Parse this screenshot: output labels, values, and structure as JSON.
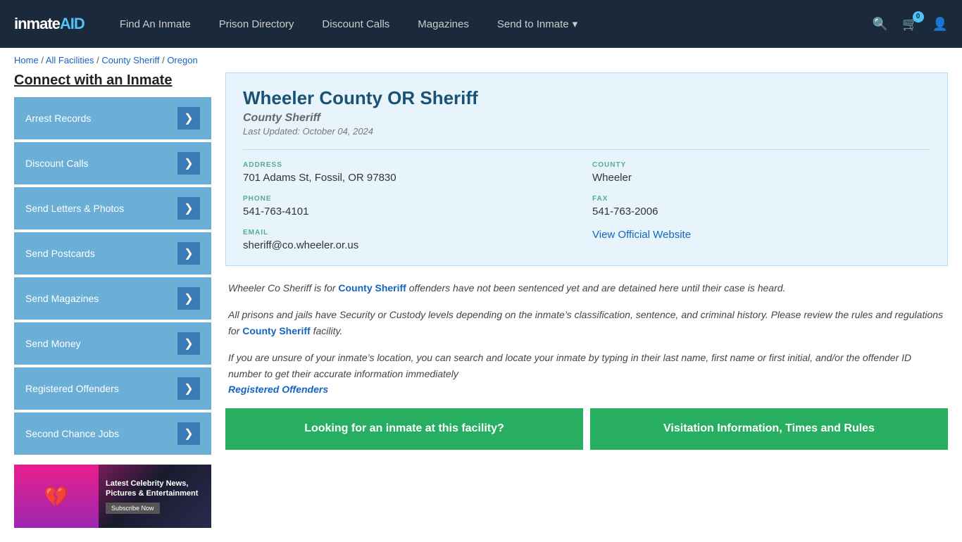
{
  "header": {
    "logo": "inmateAID",
    "logo_badge": "AID",
    "nav": [
      {
        "label": "Find An Inmate",
        "id": "find-inmate"
      },
      {
        "label": "Prison Directory",
        "id": "prison-directory"
      },
      {
        "label": "Discount Calls",
        "id": "discount-calls"
      },
      {
        "label": "Magazines",
        "id": "magazines"
      },
      {
        "label": "Send to Inmate",
        "id": "send-to-inmate",
        "dropdown": true
      }
    ],
    "cart_count": "0"
  },
  "breadcrumb": {
    "home": "Home",
    "all_facilities": "All Facilities",
    "county_sheriff": "County Sheriff",
    "oregon": "Oregon"
  },
  "sidebar": {
    "title": "Connect with an Inmate",
    "items": [
      {
        "label": "Arrest Records",
        "id": "arrest-records"
      },
      {
        "label": "Discount Calls",
        "id": "discount-calls"
      },
      {
        "label": "Send Letters & Photos",
        "id": "send-letters"
      },
      {
        "label": "Send Postcards",
        "id": "send-postcards"
      },
      {
        "label": "Send Magazines",
        "id": "send-magazines"
      },
      {
        "label": "Send Money",
        "id": "send-money"
      },
      {
        "label": "Registered Offenders",
        "id": "registered-offenders"
      },
      {
        "label": "Second Chance Jobs",
        "id": "second-chance-jobs"
      }
    ],
    "ad": {
      "title": "Latest Celebrity News, Pictures & Entertainment",
      "button": "Subscribe Now"
    }
  },
  "facility": {
    "name": "Wheeler County OR Sheriff",
    "type": "County Sheriff",
    "last_updated": "Last Updated: October 04, 2024",
    "address_label": "ADDRESS",
    "address": "701 Adams St, Fossil, OR 97830",
    "county_label": "COUNTY",
    "county": "Wheeler",
    "phone_label": "PHONE",
    "phone": "541-763-4101",
    "fax_label": "FAX",
    "fax": "541-763-2006",
    "email_label": "EMAIL",
    "email": "sheriff@co.wheeler.or.us",
    "website_label": "View Official Website",
    "website_url": "#"
  },
  "description": {
    "para1_before": "Wheeler Co Sheriff is for ",
    "para1_bold": "County Sheriff",
    "para1_after": " offenders have not been sentenced yet and are detained here until their case is heard.",
    "para2_before": "All prisons and jails have Security or Custody levels depending on the inmate’s classification, sentence, and criminal history. Please review the rules and regulations for ",
    "para2_bold": "County Sheriff",
    "para2_after": " facility.",
    "para3": "If you are unsure of your inmate’s location, you can search and locate your inmate by typing in their last name, first name or first initial, and/or the offender ID number to get their accurate information immediately",
    "para3_link": "Registered Offenders"
  },
  "buttons": {
    "inmate_search": "Looking for an inmate at this facility?",
    "visitation": "Visitation Information, Times and Rules"
  }
}
